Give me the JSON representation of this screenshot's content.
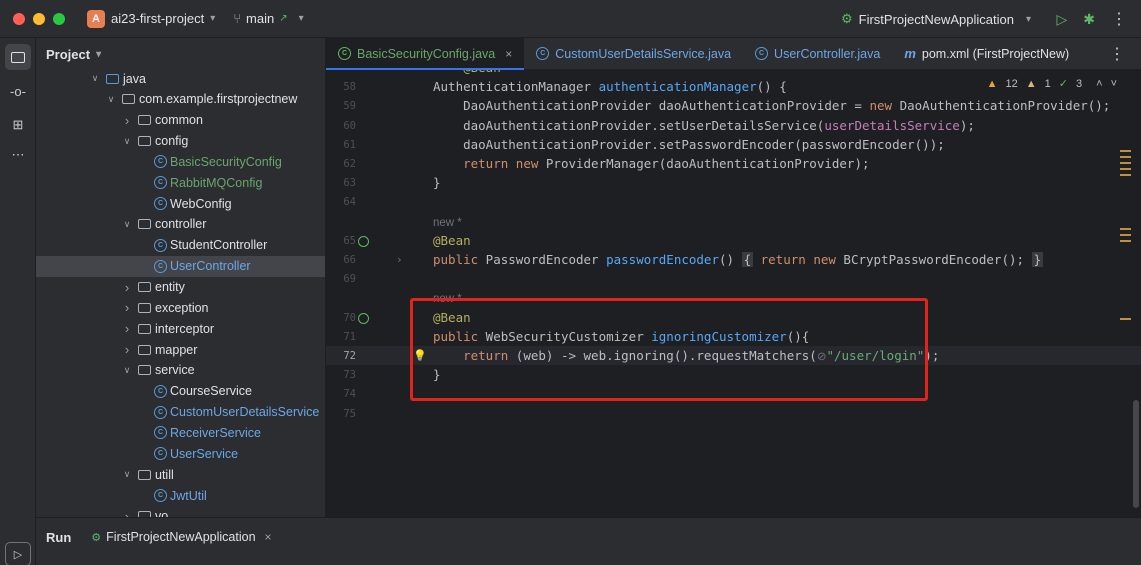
{
  "titlebar": {
    "project_initial": "A",
    "project_name": "ai23-first-project",
    "branch": "main",
    "branch_arrow": "↗",
    "run_config": "FirstProjectNewApplication"
  },
  "project_panel": {
    "title": "Project",
    "tree": [
      {
        "label": "java",
        "depth": 1,
        "kind": "java-folder",
        "twisty": "down"
      },
      {
        "label": "com.example.firstprojectnew",
        "depth": 2,
        "kind": "package",
        "twisty": "down"
      },
      {
        "label": "common",
        "depth": 3,
        "kind": "package",
        "twisty": "right"
      },
      {
        "label": "config",
        "depth": 3,
        "kind": "package",
        "twisty": "down"
      },
      {
        "label": "BasicSecurityConfig",
        "depth": 4,
        "kind": "class",
        "color": "green"
      },
      {
        "label": "RabbitMQConfig",
        "depth": 4,
        "kind": "class",
        "color": "green"
      },
      {
        "label": "WebConfig",
        "depth": 4,
        "kind": "class",
        "color": "default"
      },
      {
        "label": "controller",
        "depth": 3,
        "kind": "package",
        "twisty": "down"
      },
      {
        "label": "StudentController",
        "depth": 4,
        "kind": "class",
        "color": "default"
      },
      {
        "label": "UserController",
        "depth": 4,
        "kind": "class",
        "color": "blue",
        "selected": true
      },
      {
        "label": "entity",
        "depth": 3,
        "kind": "package",
        "twisty": "right"
      },
      {
        "label": "exception",
        "depth": 3,
        "kind": "package",
        "twisty": "right"
      },
      {
        "label": "interceptor",
        "depth": 3,
        "kind": "package",
        "twisty": "right"
      },
      {
        "label": "mapper",
        "depth": 3,
        "kind": "package",
        "twisty": "right"
      },
      {
        "label": "service",
        "depth": 3,
        "kind": "package",
        "twisty": "down"
      },
      {
        "label": "CourseService",
        "depth": 4,
        "kind": "class",
        "color": "default"
      },
      {
        "label": "CustomUserDetailsService",
        "depth": 4,
        "kind": "class",
        "color": "blue"
      },
      {
        "label": "ReceiverService",
        "depth": 4,
        "kind": "class",
        "color": "blue"
      },
      {
        "label": "UserService",
        "depth": 4,
        "kind": "class",
        "color": "blue"
      },
      {
        "label": "utill",
        "depth": 3,
        "kind": "package",
        "twisty": "down"
      },
      {
        "label": "JwtUtil",
        "depth": 4,
        "kind": "class",
        "color": "blue"
      },
      {
        "label": "vo",
        "depth": 3,
        "kind": "package",
        "twisty": "right"
      }
    ]
  },
  "tabs": [
    {
      "label": "BasicSecurityConfig.java",
      "icon": "class-icon",
      "active": true,
      "closable": true,
      "color": "green"
    },
    {
      "label": "CustomUserDetailsService.java",
      "icon": "class-icon",
      "active": false,
      "color": "blue"
    },
    {
      "label": "UserController.java",
      "icon": "class-icon",
      "active": false,
      "color": "blue"
    },
    {
      "label": "pom.xml (FirstProjectNew)",
      "icon": "maven-icon",
      "icon_text": "m",
      "active": false,
      "color": "default"
    }
  ],
  "editor": {
    "inspections": {
      "warnings": "12",
      "weak_warnings": "1",
      "ok": "3"
    },
    "lines": [
      {
        "no": "",
        "hint": "",
        "html_tokens": [
          {
            "t": "    "
          },
          {
            "t": "@Bean",
            "c": "ann"
          }
        ],
        "partial_top": true
      },
      {
        "no": "58",
        "tokens": [
          {
            "t": "AuthenticationManager "
          },
          {
            "t": "authenticationManager",
            "c": "fn"
          },
          {
            "t": "() {"
          }
        ]
      },
      {
        "no": "59",
        "tokens": [
          {
            "t": "    DaoAuthenticationProvider daoAuthenticationProvider = "
          },
          {
            "t": "new",
            "c": "kw"
          },
          {
            "t": " DaoAuthenticationProvider();"
          }
        ]
      },
      {
        "no": "60",
        "tokens": [
          {
            "t": "    daoAuthenticationProvider.setUserDetailsService("
          },
          {
            "t": "userDetailsService",
            "c": "fld"
          },
          {
            "t": ");"
          }
        ]
      },
      {
        "no": "61",
        "tokens": [
          {
            "t": "    daoAuthenticationProvider.setPasswordEncoder(passwordEncoder());"
          }
        ]
      },
      {
        "no": "62",
        "tokens": [
          {
            "t": "    "
          },
          {
            "t": "return",
            "c": "kw"
          },
          {
            "t": " "
          },
          {
            "t": "new",
            "c": "kw"
          },
          {
            "t": " ProviderManager(daoAuthenticationProvider);"
          }
        ]
      },
      {
        "no": "63",
        "tokens": [
          {
            "t": "}"
          }
        ]
      },
      {
        "no": "64",
        "tokens": []
      },
      {
        "no": "",
        "hint": "new *",
        "tokens": []
      },
      {
        "no": "65",
        "spring": true,
        "tokens": [
          {
            "t": "@Bean",
            "c": "ann"
          }
        ]
      },
      {
        "no": "66",
        "fold": true,
        "tokens": [
          {
            "t": "public",
            "c": "kw"
          },
          {
            "t": " PasswordEncoder "
          },
          {
            "t": "passwordEncoder",
            "c": "fn"
          },
          {
            "t": "() "
          },
          {
            "t": "{",
            "c": "brace"
          },
          {
            "t": " "
          },
          {
            "t": "return",
            "c": "kw"
          },
          {
            "t": " "
          },
          {
            "t": "new",
            "c": "kw"
          },
          {
            "t": " BCryptPasswordEncoder(); "
          },
          {
            "t": "}",
            "c": "brace"
          }
        ]
      },
      {
        "no": "69",
        "tokens": []
      },
      {
        "no": "",
        "hint": "new *",
        "tokens": []
      },
      {
        "no": "70",
        "spring": true,
        "tokens": [
          {
            "t": "@Bean",
            "c": "ann"
          }
        ]
      },
      {
        "no": "71",
        "tokens": [
          {
            "t": "public",
            "c": "kw"
          },
          {
            "t": " WebSecurityCustomizer "
          },
          {
            "t": "ignoringCustomizer",
            "c": "fn"
          },
          {
            "t": "(){"
          }
        ]
      },
      {
        "no": "72",
        "current": true,
        "bulb": true,
        "tokens": [
          {
            "t": "    "
          },
          {
            "t": "return",
            "c": "kw"
          },
          {
            "t": " (web) -> web.ignoring().requestMatchers("
          },
          {
            "t": "⊘",
            "c": "hint"
          },
          {
            "t": "\"/user/login\"",
            "c": "str"
          },
          {
            "t": ");"
          }
        ]
      },
      {
        "no": "73",
        "tokens": [
          {
            "t": "}"
          }
        ]
      },
      {
        "no": "74",
        "tokens": []
      },
      {
        "no": "75",
        "tokens": []
      }
    ]
  },
  "run_panel": {
    "title": "Run",
    "tab_label": "FirstProjectNewApplication"
  }
}
